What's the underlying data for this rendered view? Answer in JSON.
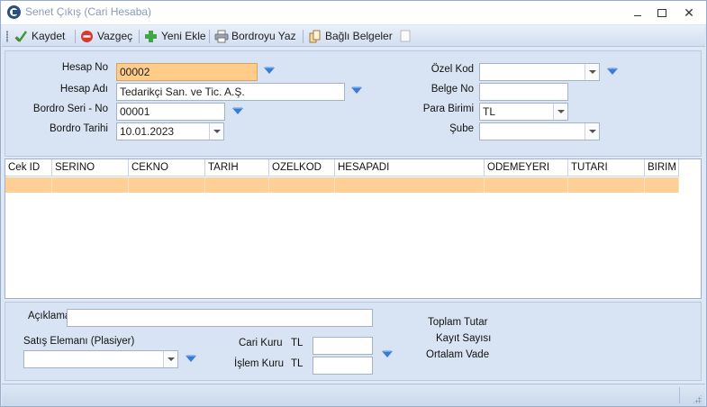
{
  "window": {
    "title": "Senet Çıkış (Cari Hesaba)"
  },
  "toolbar": {
    "save_label": "Kaydet",
    "cancel_label": "Vazgeç",
    "new_label": "Yeni Ekle",
    "print_label": "Bordroyu Yaz",
    "attachments_label": "Bağlı Belgeler"
  },
  "form": {
    "hesap_no": {
      "label": "Hesap No",
      "value": "00002"
    },
    "hesap_adi": {
      "label": "Hesap Adı",
      "value": "Tedarikçi San. ve Tic. A.Ş."
    },
    "bordro_seri_no": {
      "label": "Bordro Seri - No",
      "value": "00001"
    },
    "bordro_tarihi": {
      "label": "Bordro Tarihi",
      "value": "10.01.2023"
    },
    "ozel_kod": {
      "label": "Özel Kod",
      "value": ""
    },
    "belge_no": {
      "label": "Belge No",
      "value": ""
    },
    "para_birimi": {
      "label": "Para Birimi",
      "value": "TL"
    },
    "sube": {
      "label": "Şube",
      "value": ""
    }
  },
  "grid": {
    "columns": [
      "Cek ID",
      "SERINO",
      "CEKNO",
      "TARIH",
      "OZELKOD",
      "HESAPADI",
      "ODEMEYERI",
      "TUTARI",
      "BIRIM"
    ],
    "rows": [
      [
        "",
        "",
        "",
        "",
        "",
        "",
        "",
        "",
        ""
      ]
    ]
  },
  "bottom": {
    "aciklama": {
      "label": "Açıklama",
      "value": ""
    },
    "satis_elemani": {
      "label": "Satış Elemanı (Plasiyer)",
      "value": ""
    },
    "cari_kuru": {
      "label": "Cari Kuru",
      "currency": "TL",
      "value": ""
    },
    "islem_kuru": {
      "label": "İşlem Kuru",
      "currency": "TL",
      "value": ""
    },
    "toplam_tutar_label": "Toplam Tutar",
    "kayit_sayisi_label": "Kayıt Sayısı",
    "ortalam_vade_label": "Ortalam Vade"
  },
  "icons": {
    "lookup": "lookup-arrow-icon",
    "save": "check-icon",
    "cancel": "no-entry-icon",
    "new": "plus-icon",
    "print": "printer-icon",
    "attachments": "documents-icon"
  },
  "colors": {
    "highlight_field": "#ffcc8a",
    "selected_row": "#ffcf96",
    "panel": "#d8e4f3",
    "lookup_icon": "#3a7bd5"
  }
}
